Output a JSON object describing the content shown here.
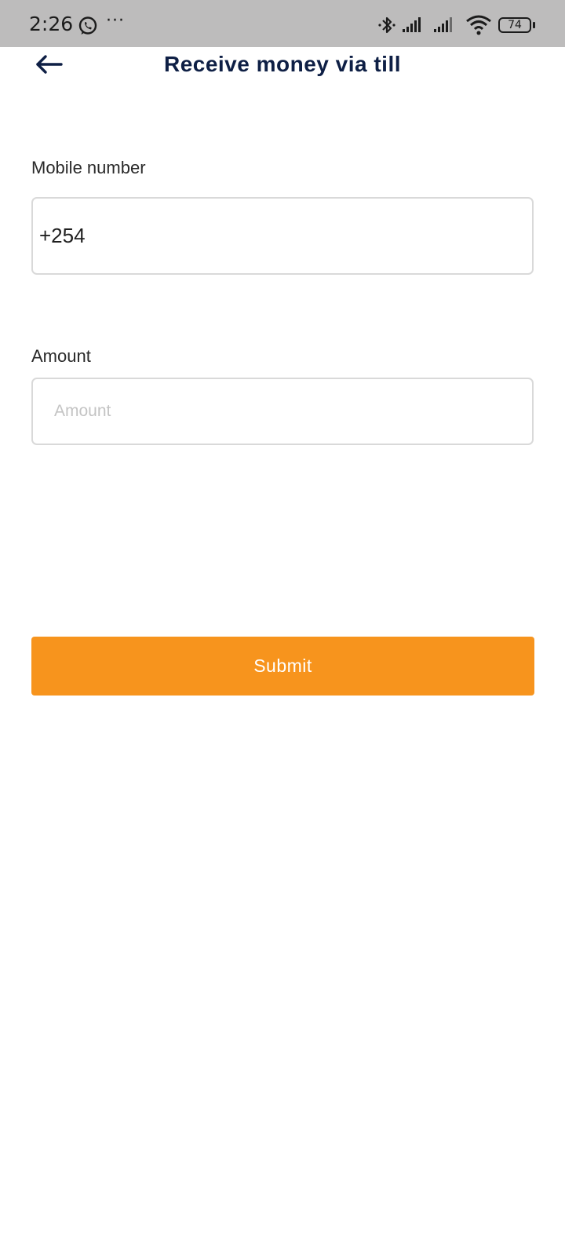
{
  "status_bar": {
    "time": "2:26",
    "more_indicator": "···",
    "battery_level": "74",
    "icons": [
      "whatsapp-icon",
      "bluetooth-icon",
      "signal-icon",
      "signal-icon",
      "wifi-icon",
      "battery-icon"
    ]
  },
  "header": {
    "back_icon": "arrow-left-icon",
    "title": "Receive money via till"
  },
  "form": {
    "mobile_label": "Mobile number",
    "mobile_value": "+254",
    "amount_label": "Amount",
    "amount_value": "",
    "amount_placeholder": "Amount",
    "submit_label": "Submit"
  },
  "colors": {
    "status_bar_bg": "#bdbcbc",
    "title": "#0e1f45",
    "accent_button": "#f7941d",
    "input_border": "#d9d9d9",
    "placeholder": "#c4c4c4"
  }
}
